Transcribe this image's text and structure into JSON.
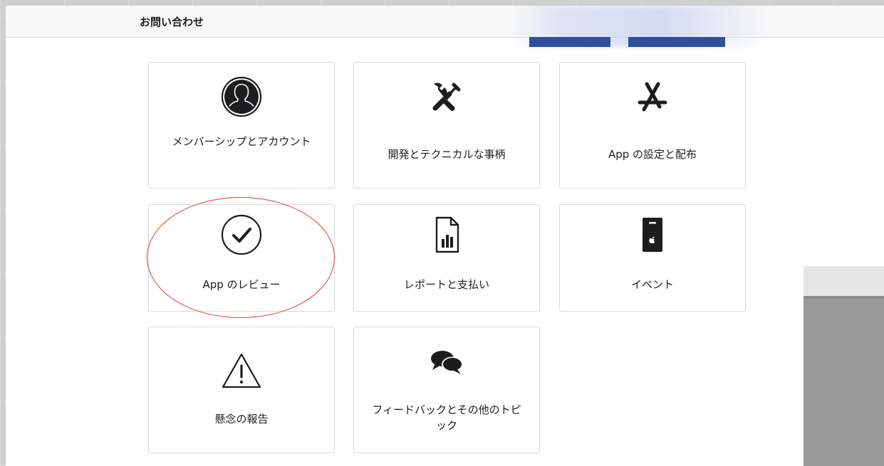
{
  "header": {
    "title": "お問い合わせ"
  },
  "tiles": [
    {
      "label": "メンバーシップとアカウント",
      "icon": "person-silhouette-icon"
    },
    {
      "label": "開発とテクニカルな事柄",
      "icon": "wrench-screwdriver-icon"
    },
    {
      "label": "App の設定と配布",
      "icon": "app-store-icon"
    },
    {
      "label": "App のレビュー",
      "icon": "checkmark-circle-icon"
    },
    {
      "label": "レポートと支払い",
      "icon": "report-chart-icon"
    },
    {
      "label": "イベント",
      "icon": "event-badge-icon"
    },
    {
      "label": "懸念の報告",
      "icon": "warning-triangle-icon"
    },
    {
      "label": "フィードバックとその他のトピック",
      "icon": "speech-bubbles-icon"
    }
  ],
  "colors": {
    "annotation": "#d9432f",
    "icon": "#1d1d1f",
    "border": "#d8d8d8"
  }
}
